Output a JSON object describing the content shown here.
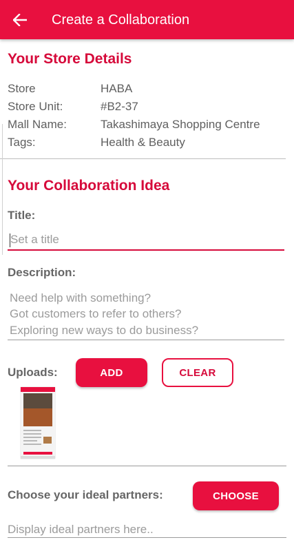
{
  "appbar": {
    "title": "Create a Collaboration",
    "back_icon": "arrow-left-icon",
    "color": "#e8103f"
  },
  "store_details": {
    "heading": "Your Store Details",
    "rows": [
      {
        "label": "Store",
        "value": "HABA"
      },
      {
        "label": "Store Unit:",
        "value": "#B2-37"
      },
      {
        "label": "Mall Name:",
        "value": "Takashimaya Shopping Centre"
      },
      {
        "label": "Tags:",
        "value": "Health & Beauty"
      }
    ]
  },
  "collab": {
    "heading": "Your Collaboration Idea",
    "title_label": "Title:",
    "title_placeholder": "Set a title",
    "description_label": "Description:",
    "description_placeholder_lines": [
      "Need help with something?",
      "Got customers to refer to others?",
      "Exploring new ways to do business?"
    ],
    "uploads_label": "Uploads:",
    "add_label": "ADD",
    "clear_label": "CLEAR",
    "partners_label": "Choose your ideal partners:",
    "choose_label": "CHOOSE",
    "partners_placeholder": "Display ideal partners here.."
  },
  "theme": {
    "accent": "#e8103f",
    "heading": "#d6093a"
  }
}
